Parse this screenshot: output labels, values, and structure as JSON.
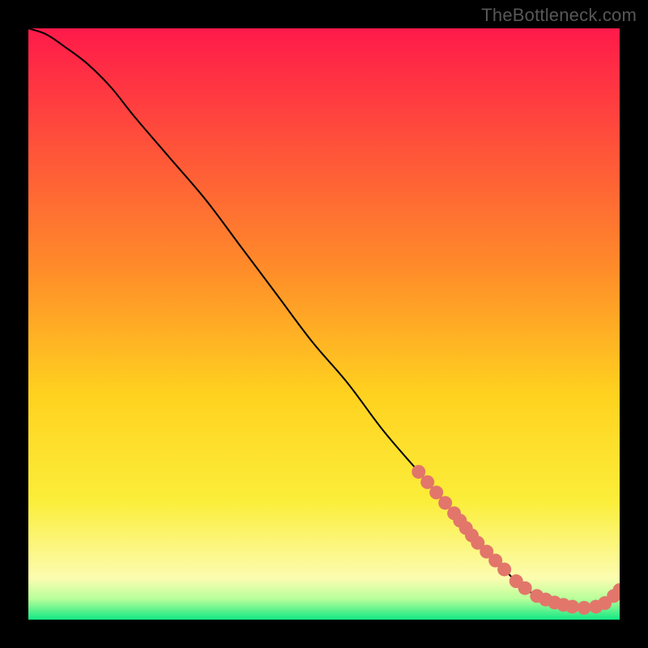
{
  "watermark": "TheBottleneck.com",
  "colors": {
    "black": "#000000",
    "curve": "#000000",
    "marker": "#e2766a",
    "grad_top": "#ff1a4a",
    "grad_mid1": "#ff7a3a",
    "grad_mid2": "#ffd21f",
    "grad_mid3": "#fff02a",
    "grad_bot": "#12e884"
  },
  "chart_data": {
    "type": "line",
    "title": "",
    "xlabel": "",
    "ylabel": "",
    "xlim": [
      0,
      100
    ],
    "ylim": [
      0,
      100
    ],
    "gradient_stops": [
      {
        "pos": 0.0,
        "color": "#ff1a4a"
      },
      {
        "pos": 0.4,
        "color": "#ff8a2a"
      },
      {
        "pos": 0.62,
        "color": "#ffd21f"
      },
      {
        "pos": 0.8,
        "color": "#fbee3a"
      },
      {
        "pos": 0.93,
        "color": "#fcfcb0"
      },
      {
        "pos": 0.965,
        "color": "#b7ff9a"
      },
      {
        "pos": 1.0,
        "color": "#12e884"
      }
    ],
    "series": [
      {
        "name": "bottleneck-curve",
        "x": [
          0,
          3,
          6,
          10,
          14,
          18,
          24,
          30,
          36,
          42,
          48,
          54,
          60,
          66,
          72,
          76,
          80,
          83,
          86,
          88,
          90,
          92,
          94,
          96,
          98,
          100
        ],
        "y": [
          100,
          99,
          97,
          94,
          90,
          85,
          78,
          71,
          63,
          55,
          47,
          40,
          32,
          25,
          18,
          13,
          9,
          6,
          4,
          3.2,
          2.6,
          2.2,
          2.0,
          2.2,
          3.0,
          5.0
        ]
      }
    ],
    "markers_along_curve_x": [
      66,
      67.5,
      69,
      70.5,
      72,
      73,
      74,
      75,
      76,
      77.5,
      79,
      80.5,
      82.5,
      84,
      86,
      87.5,
      89,
      90.5,
      92,
      94,
      96,
      97.5,
      99,
      100
    ],
    "marker_radius": 8.5
  }
}
